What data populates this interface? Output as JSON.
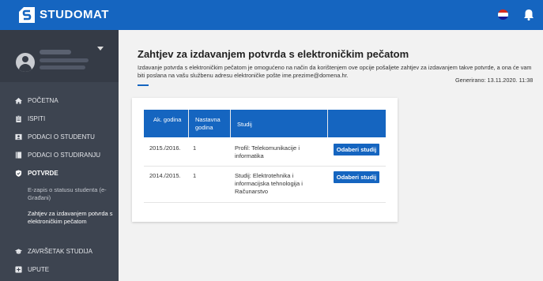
{
  "app": {
    "logo_text": "STUDOMAT",
    "flag_colors": [
      "#d52b1e",
      "#ffffff",
      "#171796"
    ]
  },
  "sidebar": {
    "items": [
      {
        "label": "POČETNA",
        "icon": "home-icon"
      },
      {
        "label": "ISPITI",
        "icon": "clipboard-icon"
      },
      {
        "label": "PODACI O STUDENTU",
        "icon": "id-card-icon"
      },
      {
        "label": "PODACI O STUDIRANJU",
        "icon": "book-icon"
      },
      {
        "label": "POTVRDE",
        "icon": "shield-check-icon"
      },
      {
        "label": "ZAVRŠETAK STUDIJA",
        "icon": "graduation-cap-icon"
      },
      {
        "label": "UPUTE",
        "icon": "plus-square-icon"
      }
    ],
    "sub_items": [
      "E-zapis o statusu studenta (e-Građani)",
      "Zahtjev za izdavanjem potvrda s elektroničkim pečatom"
    ]
  },
  "page": {
    "title": "Zahtjev za izdavanjem potvrda s elektroničkim pečatom",
    "description": "Izdavanje potvrda s elektroničkim pečatom je omogućeno na način da korištenjem ove opcije pošaljete zahtjev za izdavanjem takve potvrde, a ona će vam biti poslana na vašu službenu adresu elektroničke pošte ime.prezime@domena.hr.",
    "generated": "Generirano: 13.11.2020. 11:38"
  },
  "table": {
    "headers": [
      "Ak. godina",
      "Nastavna godina",
      "Studij",
      ""
    ],
    "rows": [
      {
        "ak_godina": "2015./2016.",
        "nastavna_godina": "1",
        "studij": "Profil: Telekomunikacije i informatika",
        "action": "Odaberi studij"
      },
      {
        "ak_godina": "2014./2015.",
        "nastavna_godina": "1",
        "studij": "Studij: Elektrotehnika i informacijska tehnologija i Računarstvo",
        "action": "Odaberi studij"
      }
    ]
  },
  "colors": {
    "primary": "#1565c0",
    "sidebar": "#3d4450"
  }
}
